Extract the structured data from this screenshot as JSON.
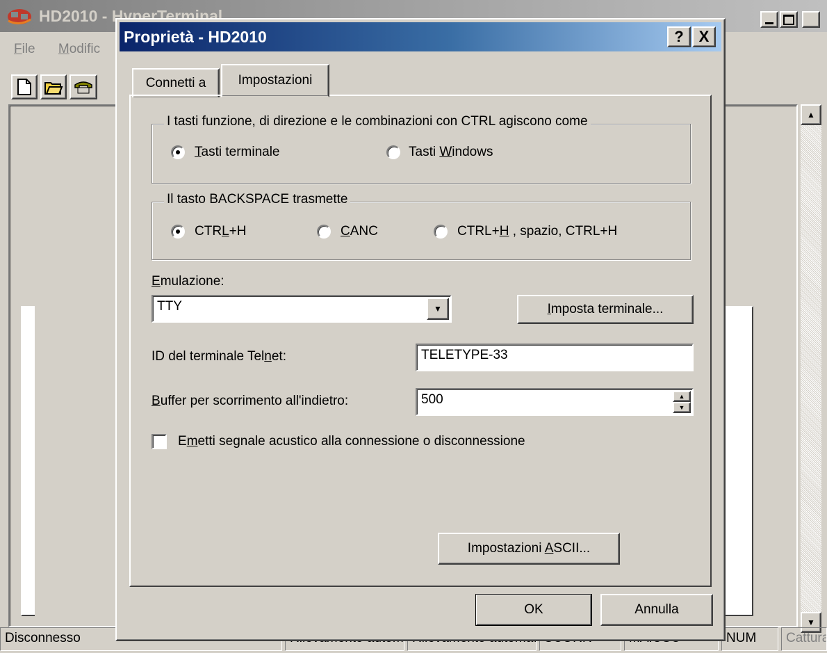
{
  "main_window": {
    "title": "HD2010 - HyperTerminal",
    "menu": [
      "File",
      "Modifica"
    ],
    "menu_underline": [
      "F",
      "M"
    ],
    "status": {
      "connection": "Disconnesso",
      "detect1": "Rilevamento automatico",
      "detect2": "Rilevamento automatico",
      "scroll": "SCORR",
      "caps": "MAIUSC",
      "num": "NUM",
      "capture": "Cattura"
    }
  },
  "dialog": {
    "title": "Proprietà - HD2010",
    "help_button": "?",
    "close_button": "X",
    "tabs": [
      {
        "label": "Connetti a",
        "active": false
      },
      {
        "label": "Impostazioni",
        "active": true
      }
    ],
    "function_keys_group": {
      "legend": "I tasti funzione, di direzione e le combinazioni con CTRL agiscono come",
      "options": [
        {
          "pre": "",
          "key": "T",
          "post": "asti terminale",
          "selected": true
        },
        {
          "pre": "Tasti ",
          "key": "W",
          "post": "indows",
          "selected": false
        }
      ]
    },
    "backspace_group": {
      "legend": "Il tasto BACKSPACE trasmette",
      "options": [
        {
          "pre": "CTR",
          "key": "L",
          "post": "+H",
          "selected": true
        },
        {
          "pre": "",
          "key": "C",
          "post": "ANC",
          "selected": false
        },
        {
          "pre": "CTRL+",
          "key": "H",
          "post": " , spazio, CTRL+H",
          "selected": false
        }
      ]
    },
    "emulation": {
      "label_key": "E",
      "label_rest": "mulazione:",
      "value": "TTY",
      "settings_button_key": "I",
      "settings_button_rest": "mposta terminale..."
    },
    "telnet_id": {
      "label_pre": "ID del terminale Tel",
      "label_key": "n",
      "label_post": "et:",
      "value": "TELETYPE-33"
    },
    "backscroll": {
      "label_key": "B",
      "label_rest": "uffer per scorrimento all'indietro:",
      "value": "500"
    },
    "beep": {
      "label_pre": "E",
      "label_key": "m",
      "label_post": "etti segnale acustico alla connessione o disconnessione",
      "checked": false
    },
    "ascii_button": {
      "pre": "Impostazioni ",
      "key": "A",
      "post": "SCII..."
    },
    "ok_button": "OK",
    "cancel_button": "Annulla"
  }
}
